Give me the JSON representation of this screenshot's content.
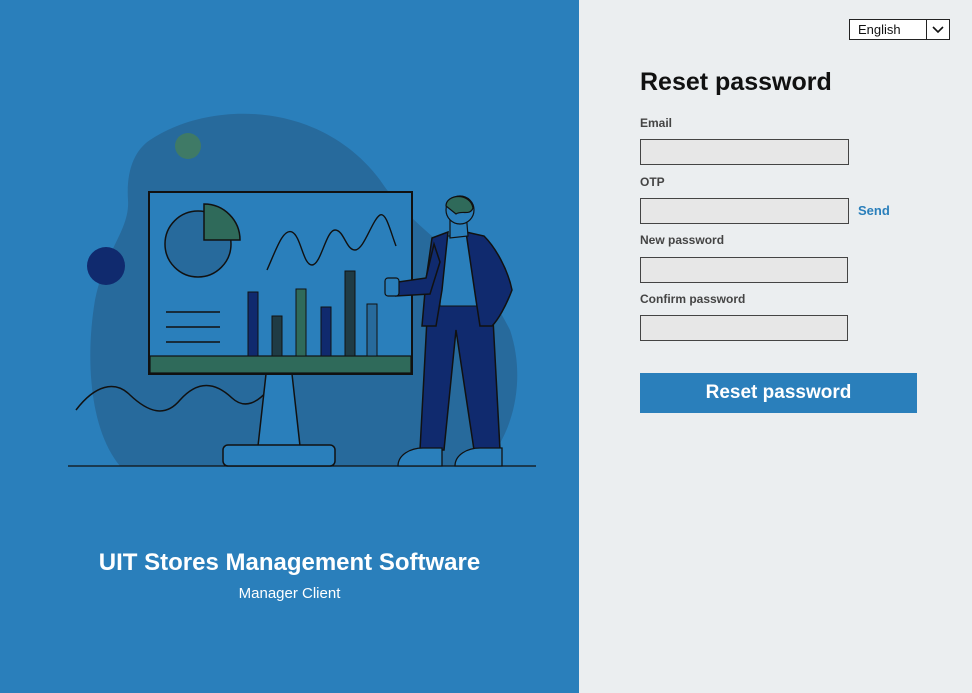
{
  "language": {
    "selected": "English"
  },
  "form": {
    "title": "Reset password",
    "email_label": "Email",
    "otp_label": "OTP",
    "send_label": "Send",
    "new_password_label": "New password",
    "confirm_password_label": "Confirm password",
    "submit_label": "Reset password"
  },
  "branding": {
    "title": "UIT Stores Management Software",
    "subtitle": "Manager Client"
  },
  "colors": {
    "accent": "#2a7fbb",
    "panel_background": "#ebeef0",
    "navy": "#102a6e",
    "teal": "#2f6a5a"
  }
}
